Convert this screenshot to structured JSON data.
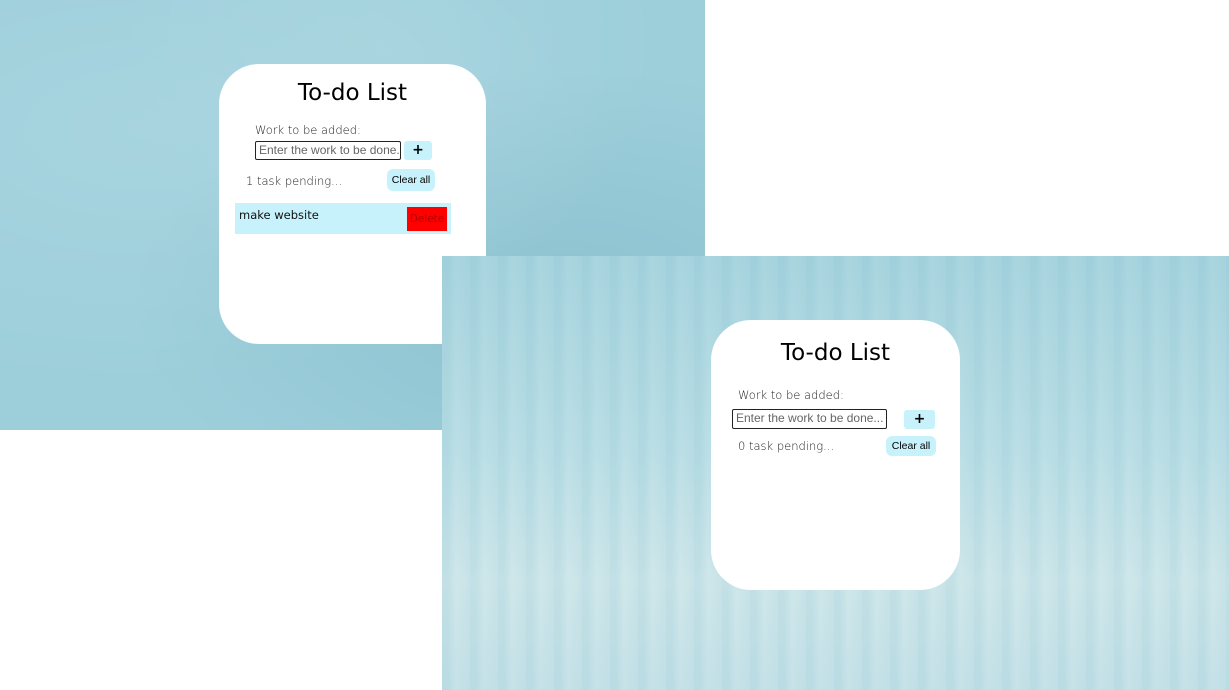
{
  "screen_1": {
    "title": "To-do List",
    "input_label": "Work to be added:",
    "input_placeholder": "Enter the work to be done...",
    "add_button": "+",
    "pending_text": "1 task pending...",
    "clear_button": "Clear all",
    "tasks": [
      {
        "text": "make website",
        "delete_label": "Delete"
      }
    ]
  },
  "screen_2": {
    "title": "To-do List",
    "input_label": "Work to be added:",
    "input_placeholder": "Enter the work to be done...",
    "add_button": "+",
    "pending_text": "0 task pending...",
    "clear_button": "Clear all",
    "tasks": []
  },
  "colors": {
    "accent_button": "#c8f2fb",
    "delete_button": "#ff0000",
    "background": "#9dcfdb"
  }
}
